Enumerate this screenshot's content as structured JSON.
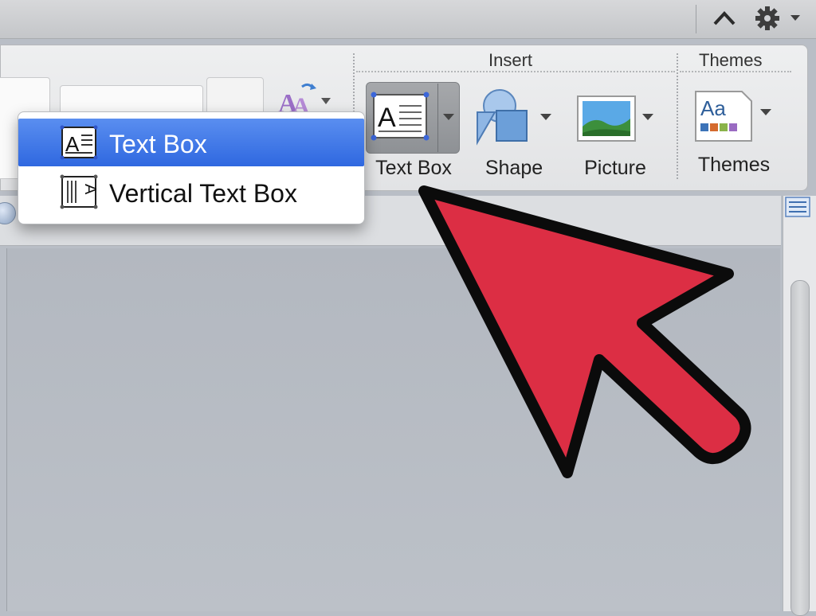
{
  "ribbon": {
    "groups": {
      "insert_title": "Insert",
      "themes_title": "Themes"
    },
    "tools": {
      "text_box_label": "Text Box",
      "shape_label": "Shape",
      "picture_label": "Picture",
      "themes_label": "Themes"
    }
  },
  "menu": {
    "items": [
      {
        "label": "Text Box",
        "icon": "text-box-icon",
        "selected": true
      },
      {
        "label": "Vertical Text Box",
        "icon": "vertical-text-box-icon",
        "selected": false
      }
    ]
  },
  "colors": {
    "menu_selection": "#3a72e6",
    "pointer_arrow": "#dc2e44"
  }
}
